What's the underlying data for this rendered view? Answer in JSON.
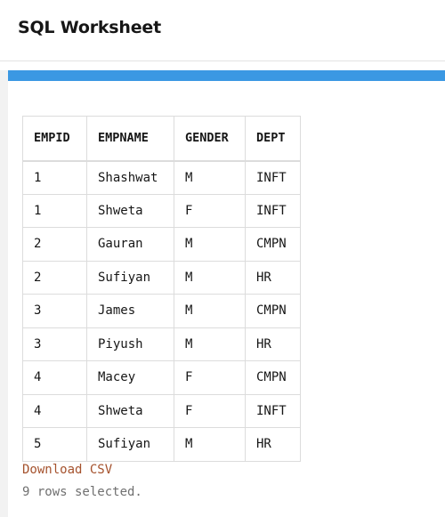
{
  "header": {
    "title": "SQL Worksheet"
  },
  "colors": {
    "accent_bar": "#3b98e3",
    "link": "#a5522d",
    "muted_text": "#707070",
    "border": "#dcdcdc"
  },
  "results": {
    "columns": [
      "EMPID",
      "EMPNAME",
      "GENDER",
      "DEPT"
    ],
    "rows": [
      [
        "1",
        "Shashwat",
        "M",
        "INFT"
      ],
      [
        "1",
        "Shweta",
        "F",
        "INFT"
      ],
      [
        "2",
        "Gauran",
        "M",
        "CMPN"
      ],
      [
        "2",
        "Sufiyan",
        "M",
        "HR"
      ],
      [
        "3",
        "James",
        "M",
        "CMPN"
      ],
      [
        "3",
        "Piyush",
        "M",
        "HR"
      ],
      [
        "4",
        "Macey",
        "F",
        "CMPN"
      ],
      [
        "4",
        "Shweta",
        "F",
        "INFT"
      ],
      [
        "5",
        "Sufiyan",
        "M",
        "HR"
      ]
    ],
    "download_label": "Download CSV",
    "row_count_text": "9 rows selected."
  }
}
